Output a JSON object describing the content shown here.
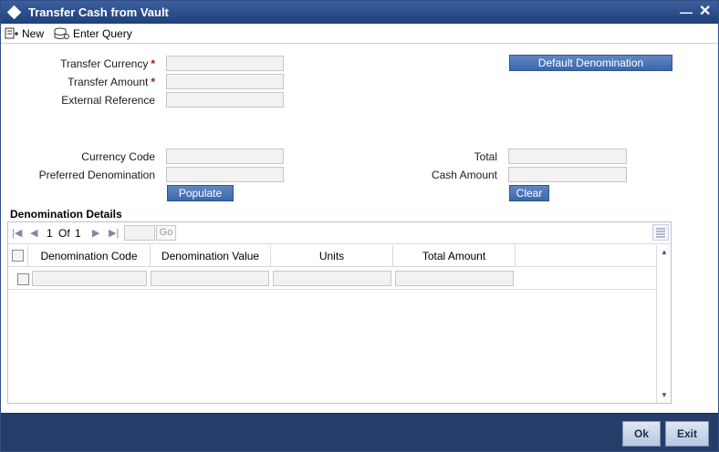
{
  "window": {
    "title": "Transfer Cash from Vault"
  },
  "toolbar": {
    "new_label": "New",
    "enter_query_label": "Enter Query"
  },
  "form": {
    "transfer_currency_label": "Transfer Currency",
    "transfer_amount_label": "Transfer Amount",
    "external_reference_label": "External Reference",
    "required_marker": "*",
    "default_denomination_label": "Default Denomination",
    "currency_code_label": "Currency Code",
    "preferred_denomination_label": "Preferred Denomination",
    "total_label": "Total",
    "cash_amount_label": "Cash Amount",
    "populate_label": "Populate",
    "clear_label": "Clear",
    "transfer_currency_value": "",
    "transfer_amount_value": "",
    "external_reference_value": "",
    "currency_code_value": "",
    "preferred_denomination_value": "",
    "total_value": "",
    "cash_amount_value": ""
  },
  "denomination": {
    "section_title": "Denomination Details",
    "pager": {
      "current": "1",
      "of_label": "Of",
      "total": "1",
      "go_label": "Go"
    },
    "columns": [
      "Denomination Code",
      "Denomination Value",
      "Units",
      "Total Amount"
    ],
    "rows": [
      {
        "code": "",
        "value": "",
        "units": "",
        "total_amount": ""
      }
    ]
  },
  "footer": {
    "ok_label": "Ok",
    "exit_label": "Exit"
  },
  "colors": {
    "title_bar": "#2c4d8a",
    "button_blue": "#4a74b6",
    "footer": "#263d6a"
  }
}
